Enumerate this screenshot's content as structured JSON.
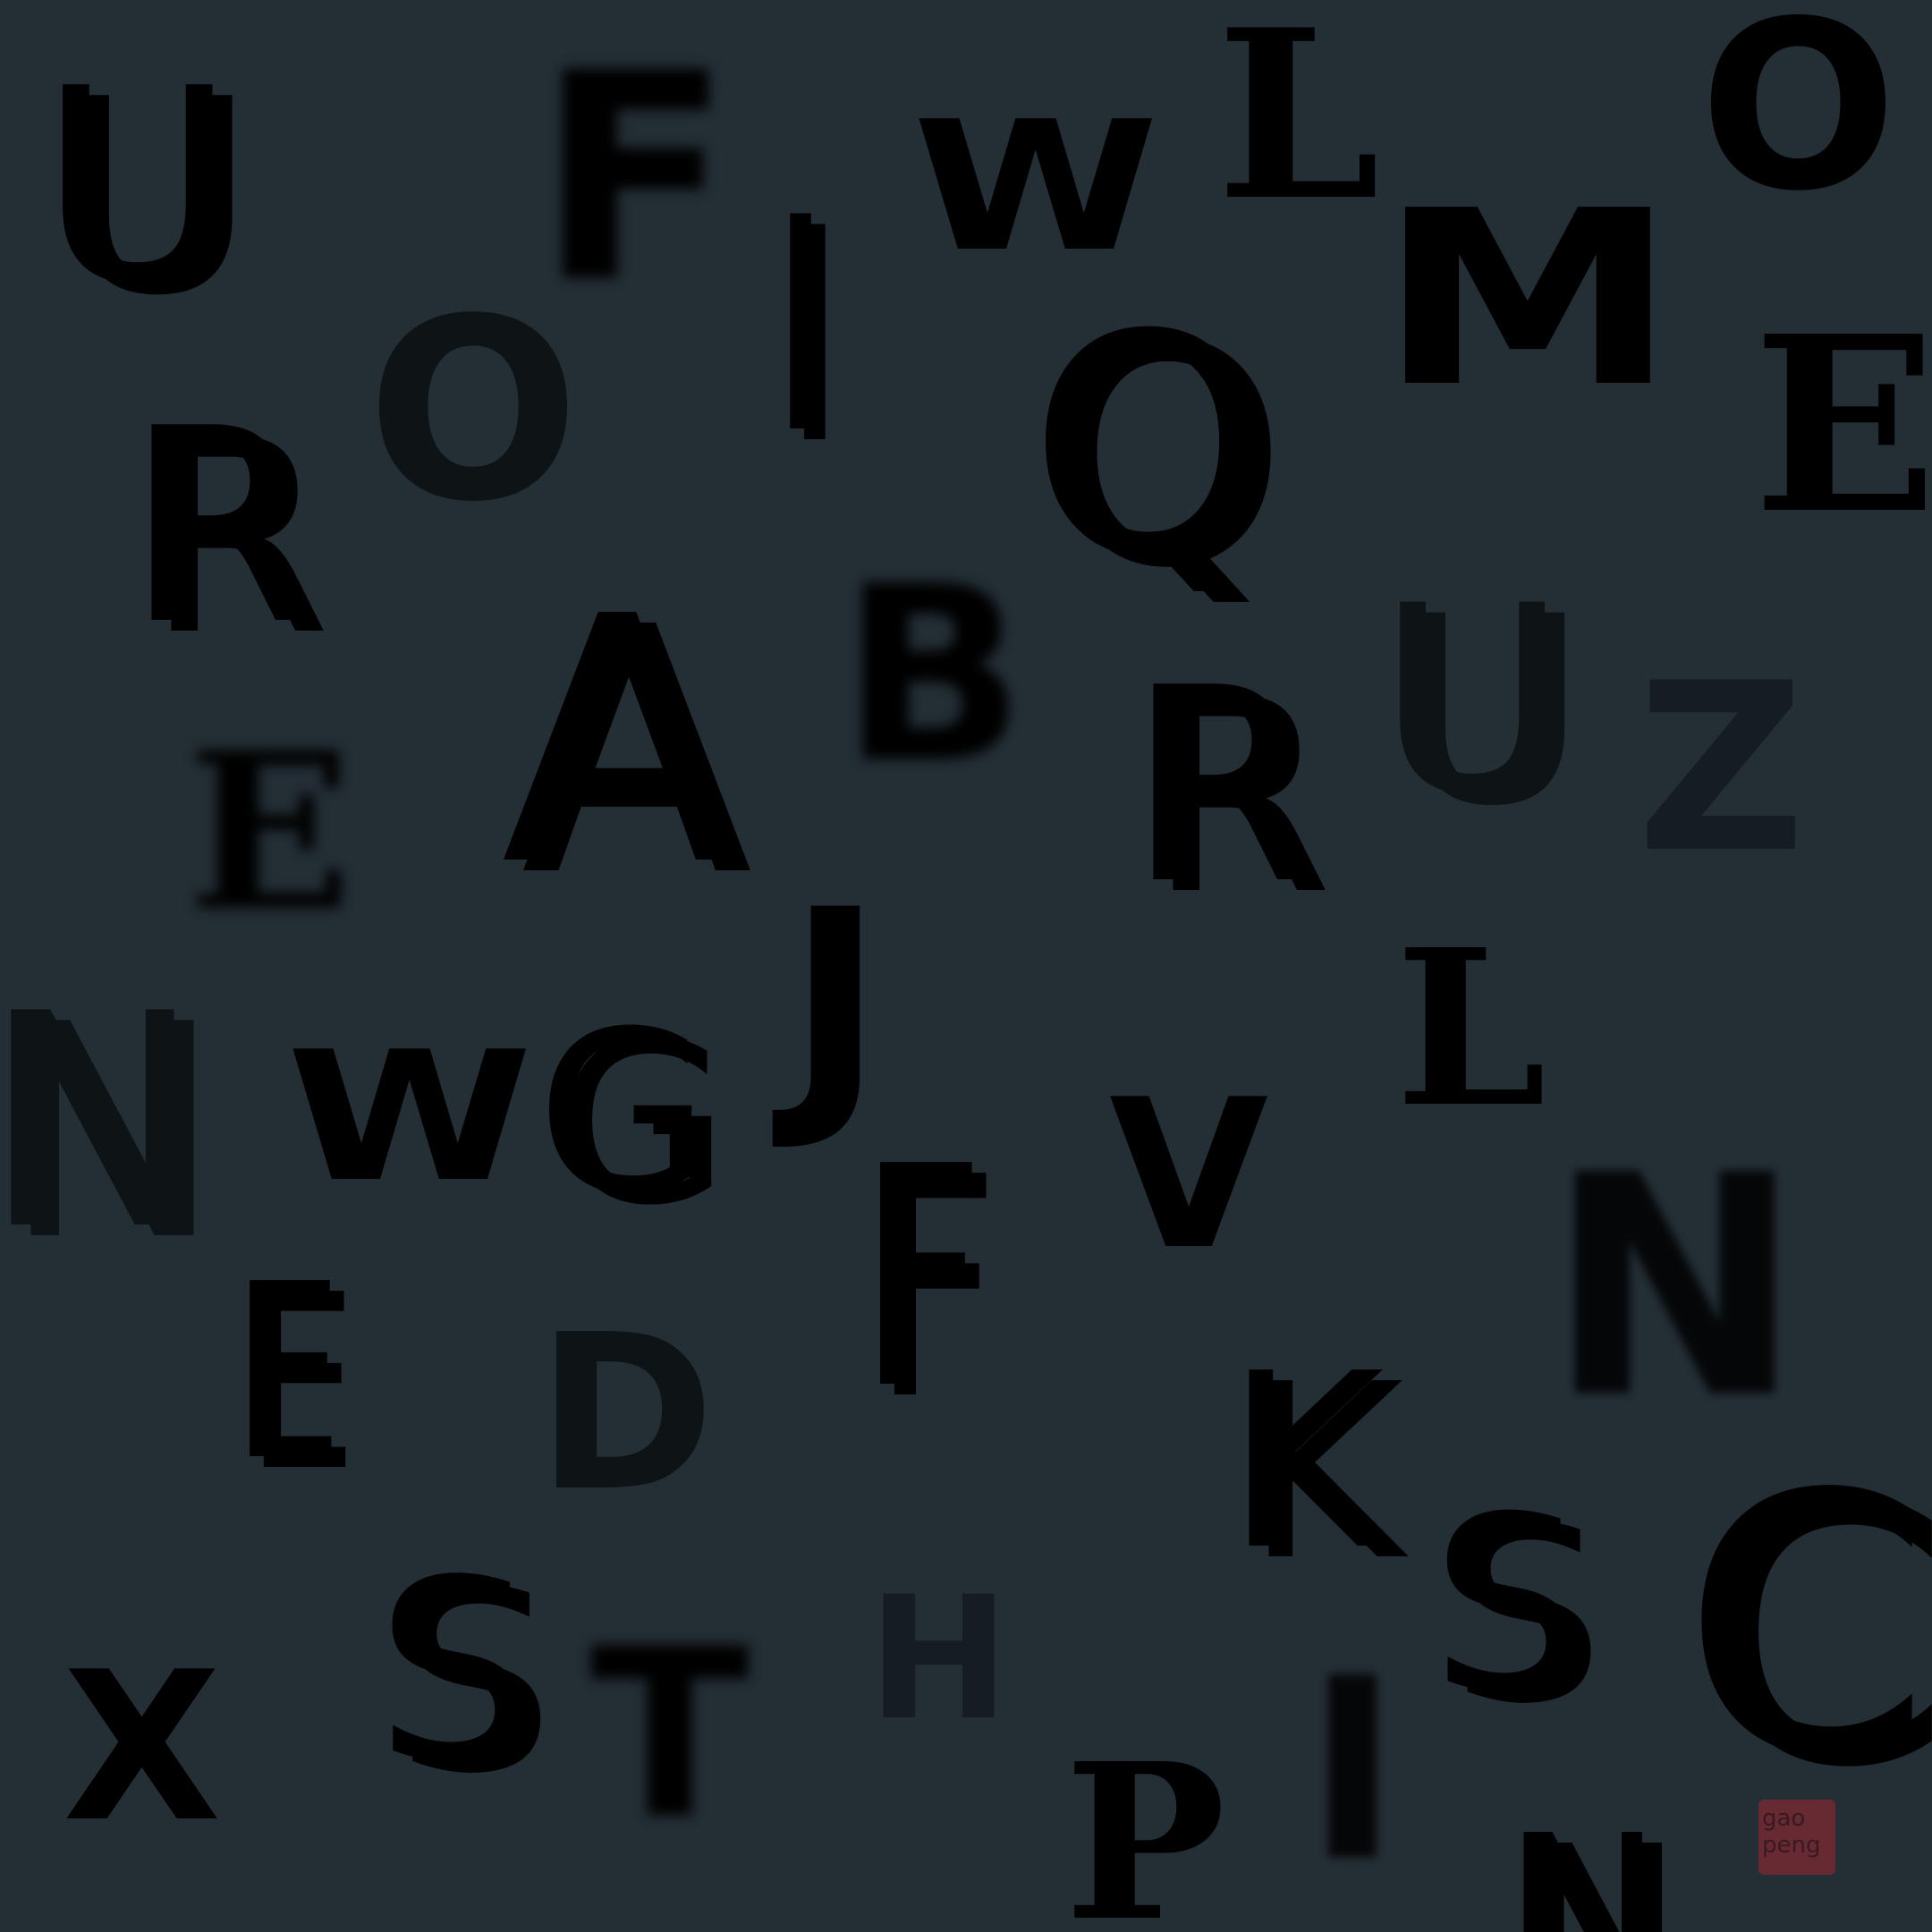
{
  "colors": {
    "background": "#232e35",
    "letter": "#000000",
    "letter_dim": "#0e1316",
    "signature_stamp": "#a0283288"
  },
  "letters": [
    "U",
    "F",
    "I",
    "W",
    "L",
    "O",
    "R",
    "O",
    "Q",
    "M",
    "E",
    "A",
    "B",
    "R",
    "U",
    "Z",
    "E",
    "J",
    "L",
    "N",
    "W",
    "G",
    "F",
    "V",
    "N",
    "E",
    "D",
    "K",
    "X",
    "S",
    "T",
    "H",
    "P",
    "I",
    "S",
    "C",
    "N"
  ],
  "signature": {
    "line1": "gao",
    "line2": "peng"
  }
}
